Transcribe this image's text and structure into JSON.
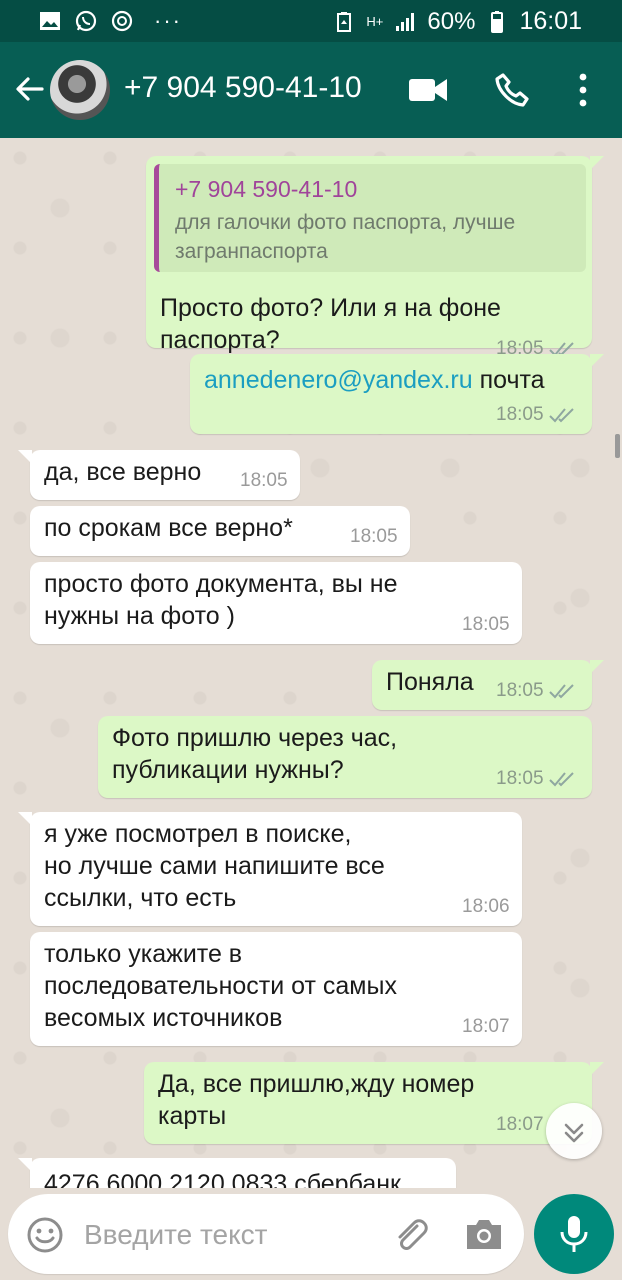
{
  "status_bar": {
    "network": "H+",
    "battery": "60%",
    "time": "16:01",
    "more_glyph": "···"
  },
  "header": {
    "contact_name": "+7 904 590-41-10",
    "icons": [
      "back-arrow-icon",
      "avatar",
      "video-call-icon",
      "phone-icon",
      "more-vert-icon"
    ]
  },
  "messages": [
    {
      "direction": "out",
      "quote_name": "+7 904 590-41-10",
      "quote_text": "для галочки фото паспорта, лучше загранпаспорта",
      "text_line1": "Просто фото? Или я на фоне",
      "text_line2": "паспорта?",
      "time": "18:05"
    },
    {
      "direction": "out",
      "link": "annedenero@yandex.ru",
      "text": " почта",
      "time": "18:05"
    },
    {
      "direction": "in",
      "text": "да, все верно",
      "time": "18:05"
    },
    {
      "direction": "in",
      "text": "по срокам все верно*",
      "time": "18:05"
    },
    {
      "direction": "in",
      "text_line1": "просто фото документа, вы не",
      "text_line2": "нужны на фото )",
      "time": "18:05"
    },
    {
      "direction": "out",
      "text": "Поняла",
      "time": "18:05"
    },
    {
      "direction": "out",
      "text_line1": "Фото пришлю через час,",
      "text_line2": "публикации нужны?",
      "time": "18:05"
    },
    {
      "direction": "in",
      "text_line1": "я уже посмотрел в поиске,",
      "text_line2": "но лучше сами напишите все",
      "text_line3": "ссылки, что есть",
      "time": "18:06"
    },
    {
      "direction": "in",
      "text_line1": "только укажите в",
      "text_line2": "последовательности от самых",
      "text_line3": "весомых источников",
      "time": "18:07"
    },
    {
      "direction": "out",
      "text_line1": "Да, все пришлю,жду номер",
      "text_line2": "карты",
      "time": "18:07"
    },
    {
      "direction": "in",
      "text": "4276 6000 2120 0833 сбербанк"
    }
  ],
  "input": {
    "placeholder": "Введите текст"
  },
  "colors": {
    "header": "#075e54",
    "status_bar": "#054d44",
    "outgoing_bubble": "#dcf8c6",
    "incoming_bubble": "#ffffff",
    "chat_background": "#e5ddd5",
    "mic_button": "#00897b",
    "link": "#1b9ec1"
  }
}
